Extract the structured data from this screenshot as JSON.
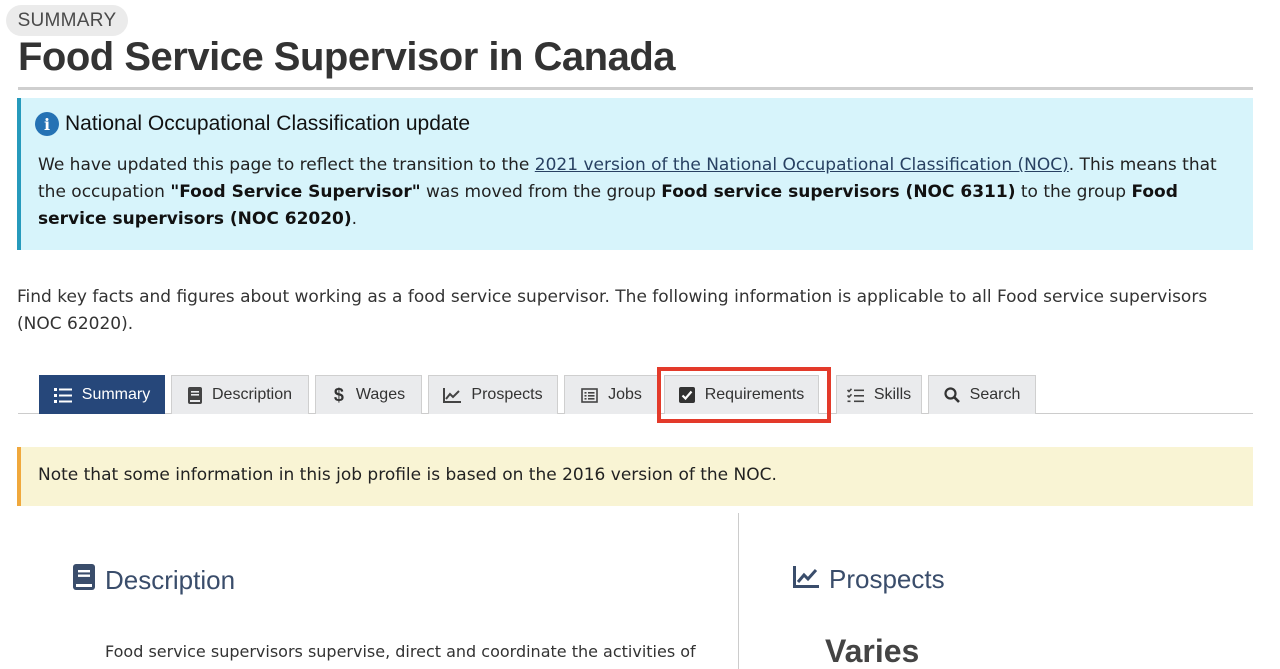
{
  "badge": "SUMMARY",
  "page_title": "Food Service Supervisor in Canada",
  "info_alert": {
    "heading": "National Occupational Classification update",
    "text_1": "We have updated this page to reflect the transition to the ",
    "link": "2021 version of the National Occupational Classification (NOC)",
    "text_2": ". This means that the occupation ",
    "occupation": "\"Food Service Supervisor\"",
    "text_3": " was moved from the group ",
    "old_group": "Food service supervisors (NOC 6311)",
    "text_4": " to the group ",
    "new_group": "Food service supervisors (NOC 62020)",
    "text_5": "."
  },
  "intro": "Find key facts and figures about working as a food service supervisor. The following information is applicable to all Food service supervisors (NOC 62020).",
  "tabs": [
    {
      "label": "Summary",
      "icon": "list-icon",
      "active": true
    },
    {
      "label": "Description",
      "icon": "book-icon"
    },
    {
      "label": "Wages",
      "icon": "dollar-icon"
    },
    {
      "label": "Prospects",
      "icon": "line-chart-icon"
    },
    {
      "label": "Jobs",
      "icon": "list-alt-icon"
    },
    {
      "label": "Requirements",
      "icon": "checkbox-icon",
      "highlighted": true
    },
    {
      "label": "Skills",
      "icon": "tasks-icon"
    },
    {
      "label": "Search",
      "icon": "search-icon"
    }
  ],
  "warning_note": "Note that some information in this job profile is based on the 2016 version of the NOC.",
  "description": {
    "heading": "Description",
    "text": "Food service supervisors supervise, direct and coordinate the activities of"
  },
  "prospects": {
    "heading": "Prospects",
    "value": "Varies"
  },
  "colors": {
    "active_tab": "#26477a",
    "info_bg": "#d7f4fb",
    "warning_bg": "#f9f4d4",
    "highlight": "#e33a2a"
  }
}
